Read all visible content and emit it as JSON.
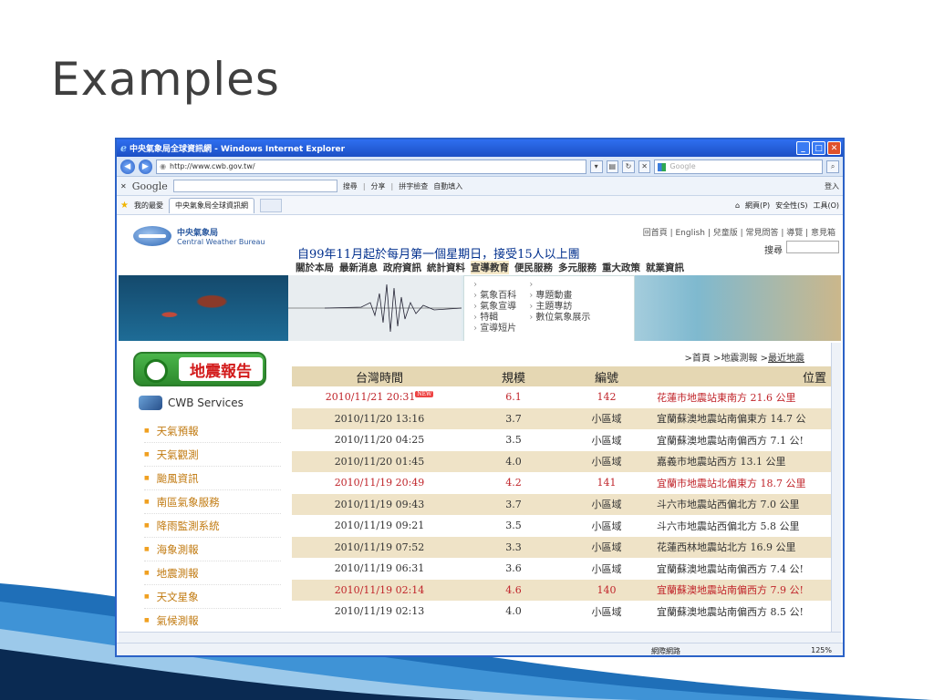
{
  "slide": {
    "title": "Examples"
  },
  "browser": {
    "title": "中央氣象局全球資訊網 - Windows Internet Explorer",
    "url": "http://www.cwb.gov.tw/",
    "search_placeholder": "Google",
    "google_bar": {
      "logo": "Google",
      "items": [
        "搜尋",
        "分享",
        "拼字檢查",
        "自動填入"
      ],
      "signin": "登入"
    },
    "favorites": {
      "label": "我的最愛",
      "tab": "中央氣象局全球資訊網"
    },
    "cmd": [
      "網頁(P)",
      "安全性(S)",
      "工具(O)"
    ]
  },
  "site": {
    "logo_cn": "中央氣象局",
    "logo_en": "Central Weather Bureau",
    "top_links": "回首頁 | English | 兒童版 | 常見問答 | 導覽 | 意見箱",
    "search_label": "搜尋",
    "marquee": "自99年11月起於每月第一個星期日，接受15人以上團",
    "nav": [
      "關於本局",
      "最新消息",
      "政府資訊",
      "統計資料",
      "宣導教育",
      "便民服務",
      "多元服務",
      "重大政策",
      "就業資訊"
    ],
    "dropdown": {
      "col1": [
        "氣象百科",
        "氣象宣導",
        "特輯",
        "宣導短片"
      ],
      "col2": [
        "專題動畫",
        "主題專訪",
        "數位氣象展示"
      ]
    },
    "quake_badge": "地震報告",
    "cwb_services": "CWB Services",
    "services": [
      "天氣預報",
      "天氣觀測",
      "颱風資訊",
      "南區氣象服務",
      "降雨監測系統",
      "海象測報",
      "地震測報",
      "天文星象",
      "氣候測報"
    ],
    "breadcrumb": {
      "home": "首頁",
      "mid": "地震測報",
      "current": "最近地震"
    },
    "table": {
      "headers": [
        "台灣時間",
        "規模",
        "編號",
        "位置"
      ],
      "new_tag": "NEW",
      "rows": [
        {
          "time": "2010/11/21 20:31",
          "mag": "6.1",
          "id": "142",
          "loc": "花蓮市地震站東南方 21.6 公里",
          "red": true
        },
        {
          "time": "2010/11/20 13:16",
          "mag": "3.7",
          "id": "小區域",
          "loc": "宜蘭蘇澳地震站南偏東方 14.7 公",
          "red": false
        },
        {
          "time": "2010/11/20 04:25",
          "mag": "3.5",
          "id": "小區域",
          "loc": "宜蘭蘇澳地震站南偏西方 7.1 公!",
          "red": false
        },
        {
          "time": "2010/11/20 01:45",
          "mag": "4.0",
          "id": "小區域",
          "loc": "嘉義市地震站西方 13.1 公里",
          "red": false
        },
        {
          "time": "2010/11/19 20:49",
          "mag": "4.2",
          "id": "141",
          "loc": "宜蘭市地震站北偏東方 18.7 公里",
          "red": true
        },
        {
          "time": "2010/11/19 09:43",
          "mag": "3.7",
          "id": "小區域",
          "loc": "斗六市地震站西偏北方 7.0 公里",
          "red": false
        },
        {
          "time": "2010/11/19 09:21",
          "mag": "3.5",
          "id": "小區域",
          "loc": "斗六市地震站西偏北方 5.8 公里",
          "red": false
        },
        {
          "time": "2010/11/19 07:52",
          "mag": "3.3",
          "id": "小區域",
          "loc": "花蓮西林地震站北方 16.9 公里",
          "red": false
        },
        {
          "time": "2010/11/19 06:31",
          "mag": "3.6",
          "id": "小區域",
          "loc": "宜蘭蘇澳地震站南偏西方 7.4 公!",
          "red": false
        },
        {
          "time": "2010/11/19 02:14",
          "mag": "4.6",
          "id": "140",
          "loc": "宜蘭蘇澳地震站南偏西方 7.9 公!",
          "red": true
        },
        {
          "time": "2010/11/19 02:13",
          "mag": "4.0",
          "id": "小區域",
          "loc": "宜蘭蘇澳地震站南偏西方 8.5 公!",
          "red": false
        }
      ]
    }
  },
  "status": {
    "zone": "網際網路",
    "zoom": "125%"
  },
  "colors": {
    "title_blue": "#2f6ff0",
    "table_header": "#e5d7b3",
    "alert_red": "#c0242a"
  }
}
